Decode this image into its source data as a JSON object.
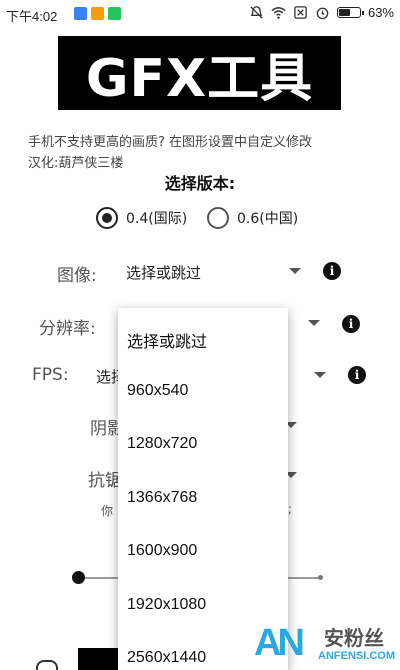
{
  "status_bar": {
    "time": "下午4:02",
    "battery_text": "63%",
    "battery_level": 0.63,
    "icons": [
      "shield-app-icon",
      "orange-app-icon",
      "green-app-icon",
      "mute-icon",
      "wifi-icon",
      "sim-icon",
      "alarm-icon",
      "battery-icon"
    ],
    "colors": {
      "shield": "#3b82f6",
      "orange": "#f59e0b",
      "green": "#22c55e"
    }
  },
  "banner": {
    "title": "GFX工具"
  },
  "hint": "手机不支持更高的画质? 在图形设置中自定义修改",
  "credit": "汉化:葫芦侠三楼",
  "version": {
    "title": "选择版本:",
    "options": [
      {
        "label": "0.4(国际)",
        "selected": true
      },
      {
        "label": "0.6(中国)",
        "selected": false
      }
    ]
  },
  "settings": {
    "image": {
      "label": "图像:",
      "value": "选择或跳过"
    },
    "resolution": {
      "label": "分辨率:"
    },
    "fps": {
      "label": "FPS:",
      "value_partial": "选择"
    },
    "shadow": {
      "label": "阴影"
    },
    "antialias": {
      "label": "抗锯"
    },
    "note_left": "你",
    "note_right": ";"
  },
  "dropdown": {
    "items": [
      "选择或跳过",
      "960x540",
      "1280x720",
      "1366x768",
      "1600x900",
      "1920x1080",
      "2560x1440"
    ]
  },
  "watermark": {
    "logo": "AN",
    "cn": "安粉丝",
    "en": "ANFENSI.COM"
  }
}
